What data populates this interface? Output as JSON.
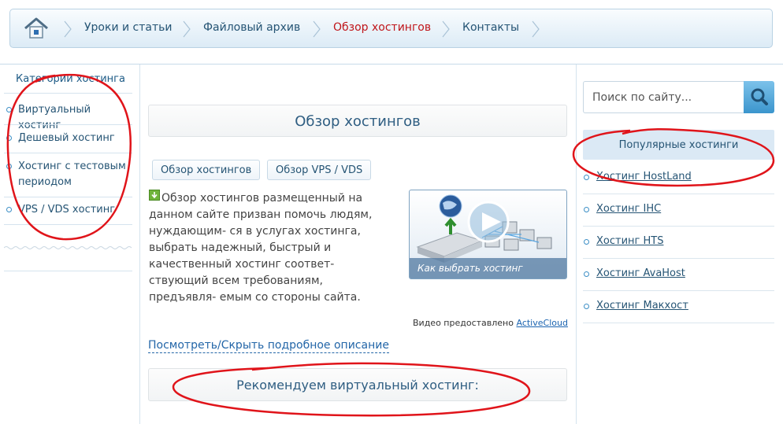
{
  "nav": {
    "home_label": "",
    "items": [
      {
        "label": "Уроки и статьи",
        "active": false
      },
      {
        "label": "Файловый архив",
        "active": false
      },
      {
        "label": "Обзор хостингов",
        "active": true
      },
      {
        "label": "Контакты",
        "active": false
      }
    ]
  },
  "left": {
    "heading": "Категории хостинга",
    "items": [
      {
        "label": "Виртуальный хостинг"
      },
      {
        "label": "Дешевый хостинг"
      },
      {
        "label": "Хостинг с тестовым периодом"
      },
      {
        "label": "VPS / VDS хостинг"
      }
    ]
  },
  "main": {
    "title": "Обзор хостингов",
    "tabs": [
      "Обзор хостингов",
      "Обзор VPS / VDS"
    ],
    "description": "Обзор хостингов размещенный на данном сайте призван помочь людям, нуждающим- ся в услугах хостинга, выбрать надежный, быстрый и качественный хостинг соответ- ствующий всем требованиям, предъявля- емым со стороны сайта.",
    "video_caption": "Как выбрать хостинг",
    "credit_prefix": "Видео предоставлено",
    "credit_link": "ActiveCloud",
    "toggle_label": "Посмотреть/Скрыть подробное описание",
    "recommend_title": "Рекомендуем виртуальный хостинг:"
  },
  "right": {
    "search_placeholder": "Поиск по сайту...",
    "heading": "Популярные хостинги",
    "items": [
      {
        "label": "Хостинг HostLand"
      },
      {
        "label": "Хостинг IHC"
      },
      {
        "label": "Хостинг HTS"
      },
      {
        "label": "Хостинг AvaHost"
      },
      {
        "label": "Хостинг Макхост"
      }
    ]
  },
  "colors": {
    "accent": "#255474",
    "active_nav": "#c0161b",
    "annotation": "#e0141a"
  }
}
